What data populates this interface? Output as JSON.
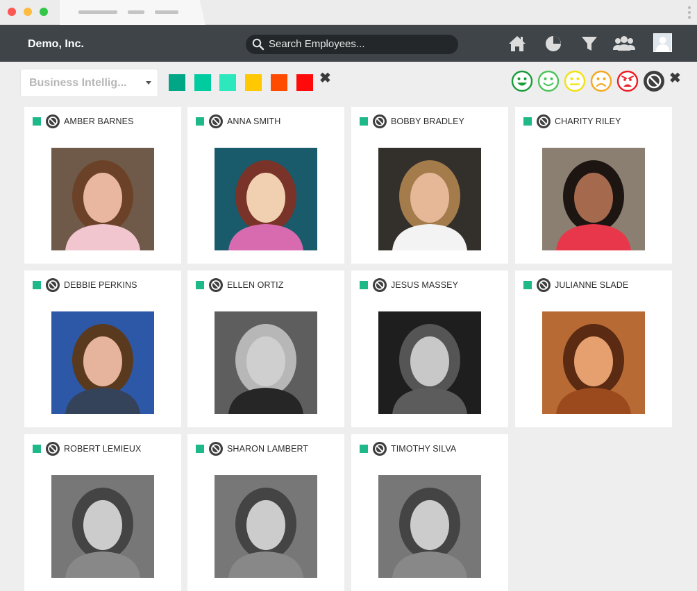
{
  "window": {
    "controls": [
      "close",
      "minimize",
      "zoom"
    ]
  },
  "header": {
    "brand": "Demo, Inc.",
    "search_placeholder": "Search Employees...",
    "nav_icons": [
      "home-icon",
      "pie-chart-icon",
      "filter-icon",
      "people-icon",
      "user-avatar"
    ]
  },
  "filters": {
    "department": "Business Intellig...",
    "color_swatches": [
      "#00a685",
      "#00cca0",
      "#2de8bd",
      "#ffc800",
      "#ff4b00",
      "#ff0a0a"
    ],
    "mood_faces": [
      {
        "name": "very-happy",
        "color": "#1a9b3b"
      },
      {
        "name": "happy",
        "color": "#4dc45a"
      },
      {
        "name": "neutral",
        "color": "#f2e214"
      },
      {
        "name": "sad",
        "color": "#f5a820"
      },
      {
        "name": "angry",
        "color": "#ee1c24"
      },
      {
        "name": "none",
        "color": "#3e3e3e"
      }
    ]
  },
  "employees": [
    {
      "name": "AMBER BARNES",
      "status_color": "#1fb889"
    },
    {
      "name": "ANNA SMITH",
      "status_color": "#1fb889"
    },
    {
      "name": "BOBBY BRADLEY",
      "status_color": "#1fb889"
    },
    {
      "name": "CHARITY RILEY",
      "status_color": "#1fb889"
    },
    {
      "name": "DEBBIE PERKINS",
      "status_color": "#1fb889"
    },
    {
      "name": "ELLEN ORTIZ",
      "status_color": "#1fb889"
    },
    {
      "name": "JESUS MASSEY",
      "status_color": "#1fb889"
    },
    {
      "name": "JULIANNE SLADE",
      "status_color": "#1fb889"
    },
    {
      "name": "ROBERT LEMIEUX",
      "status_color": "#1fb889"
    },
    {
      "name": "SHARON LAMBERT",
      "status_color": "#1fb889"
    },
    {
      "name": "TIMOTHY SILVA",
      "status_color": "#1fb889"
    }
  ]
}
